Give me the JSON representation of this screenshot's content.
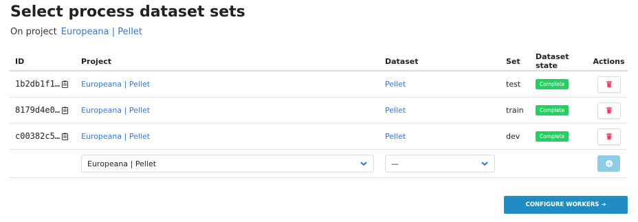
{
  "page": {
    "title": "Select process dataset sets",
    "subtitle_prefix": "On project",
    "project_link": "Europeana | Pellet"
  },
  "table": {
    "headers": {
      "id": "ID",
      "project": "Project",
      "dataset": "Dataset",
      "set": "Set",
      "state": "Dataset state",
      "actions": "Actions"
    },
    "rows": [
      {
        "id": "1b2db1f1…",
        "project": "Europeana | Pellet",
        "dataset": "Pellet",
        "set": "test",
        "state": "Complete"
      },
      {
        "id": "8179d4e0…",
        "project": "Europeana | Pellet",
        "dataset": "Pellet",
        "set": "train",
        "state": "Complete"
      },
      {
        "id": "c00382c5…",
        "project": "Europeana | Pellet",
        "dataset": "Pellet",
        "set": "dev",
        "state": "Complete"
      }
    ],
    "new_row": {
      "project_select": "Europeana | Pellet",
      "dataset_select": "—"
    }
  },
  "icons": {
    "copy": "clipboard-icon",
    "delete": "trash-icon",
    "select": "chevron-down-icon",
    "add": "plus-circle-icon",
    "configure": "arrow-right-icon"
  },
  "colors": {
    "link": "#3273dc",
    "complete_tag": "#23d160",
    "delete_icon": "#ff3860",
    "add_button": "#8fcbe6",
    "configure_button": "#1f8dc4"
  },
  "footer": {
    "configure_label": "CONFIGURE WORKERS",
    "configure_arrow": "➔"
  }
}
